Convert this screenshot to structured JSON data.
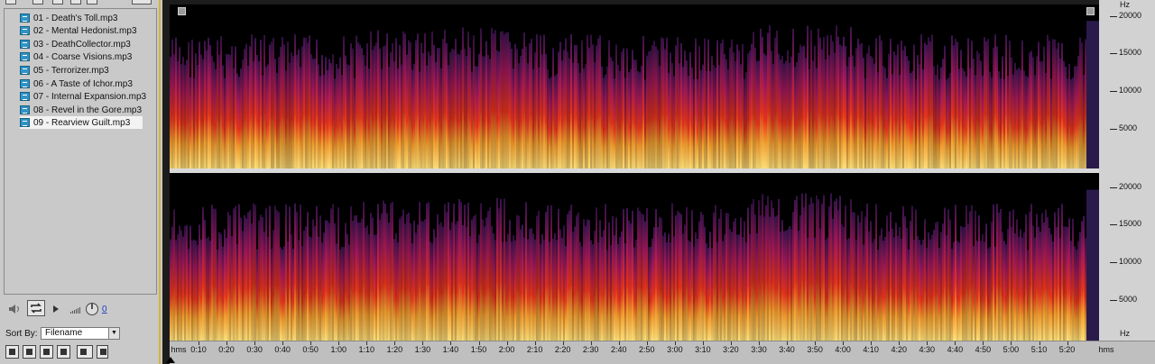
{
  "file_panel": {
    "files": [
      "01 - Death's Toll.mp3",
      "02 - Mental Hedonist.mp3",
      "03 - DeathCollector.mp3",
      "04 - Coarse Visions.mp3",
      "05 - Terrorizer.mp3",
      "06 - A Taste of Ichor.mp3",
      "07 - Internal Expansion.mp3",
      "08 - Revel in the Gore.mp3",
      "09 - Rearview Guilt.mp3"
    ],
    "selected_file": "09 - Rearview Guilt.mp3"
  },
  "transport": {
    "volume_value": "0"
  },
  "sort": {
    "label": "Sort By:",
    "value": "Filename"
  },
  "frequency_ruler": {
    "unit": "Hz",
    "labels": [
      "20000",
      "15000",
      "10000",
      "5000"
    ]
  },
  "time_ruler": {
    "start_label": "hms",
    "end_label": "hms",
    "labels": [
      "0:10",
      "0:20",
      "0:30",
      "0:40",
      "0:50",
      "1:00",
      "1:10",
      "1:20",
      "1:30",
      "1:40",
      "1:50",
      "2:00",
      "2:10",
      "2:20",
      "2:30",
      "2:40",
      "2:50",
      "3:00",
      "3:10",
      "3:20",
      "3:30",
      "3:40",
      "3:50",
      "4:00",
      "4:10",
      "4:20",
      "4:30",
      "4:40",
      "4:50",
      "5:00",
      "5:10",
      "5:20"
    ]
  },
  "colors": {
    "spectrum_low": "#ffe07a",
    "spectrum_mid": "#e8341c",
    "spectrum_high": "#3a1450",
    "panel_border": "#d6b23a",
    "selection": "#f3f3f3"
  }
}
